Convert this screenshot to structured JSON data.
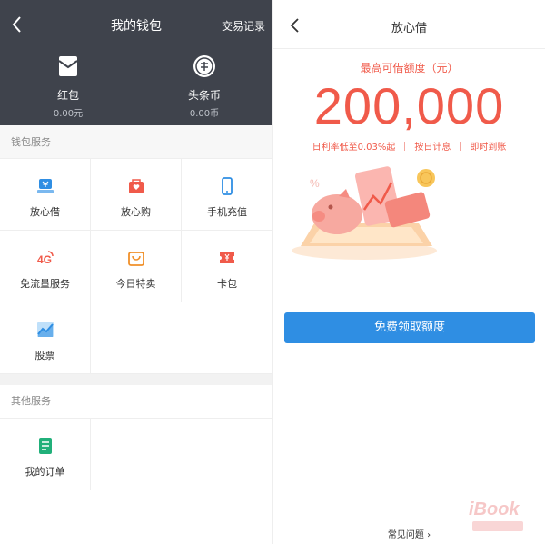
{
  "wallet": {
    "title": "我的钱包",
    "transactions_link": "交易记录",
    "assets": [
      {
        "name": "红包",
        "value": "0.00元",
        "icon": "red-envelope-icon"
      },
      {
        "name": "头条币",
        "value": "0.00币",
        "icon": "coin-icon"
      }
    ],
    "sections": [
      {
        "label": "钱包服务",
        "items": [
          {
            "label": "放心借",
            "icon": "loan-icon",
            "color": "#2f8ee3"
          },
          {
            "label": "放心购",
            "icon": "shopping-bag-icon",
            "color": "#f05a4a"
          },
          {
            "label": "手机充值",
            "icon": "phone-icon",
            "color": "#2f8ee3"
          },
          {
            "label": "免流量服务",
            "icon": "4g-icon",
            "color": "#f05a4a"
          },
          {
            "label": "今日特卖",
            "icon": "bag-icon",
            "color": "#f0902a"
          },
          {
            "label": "卡包",
            "icon": "ticket-icon",
            "color": "#f05a4a"
          },
          {
            "label": "股票",
            "icon": "stock-chart-icon",
            "color": "#2f8ee3"
          }
        ]
      },
      {
        "label": "其他服务",
        "items": [
          {
            "label": "我的订单",
            "icon": "order-icon",
            "color": "#21b07a"
          }
        ]
      }
    ]
  },
  "loan": {
    "title": "放心借",
    "limit_label": "最高可借额度（元）",
    "limit_value": "200,000",
    "features": [
      "日利率低至0.03%起",
      "按日计息",
      "即时到账"
    ],
    "cta_label": "免费领取额度",
    "faq_label": "常见问题 ›"
  },
  "colors": {
    "header_bg": "#3f434c",
    "accent_red": "#f05a4a",
    "accent_blue": "#2f8ee3"
  }
}
